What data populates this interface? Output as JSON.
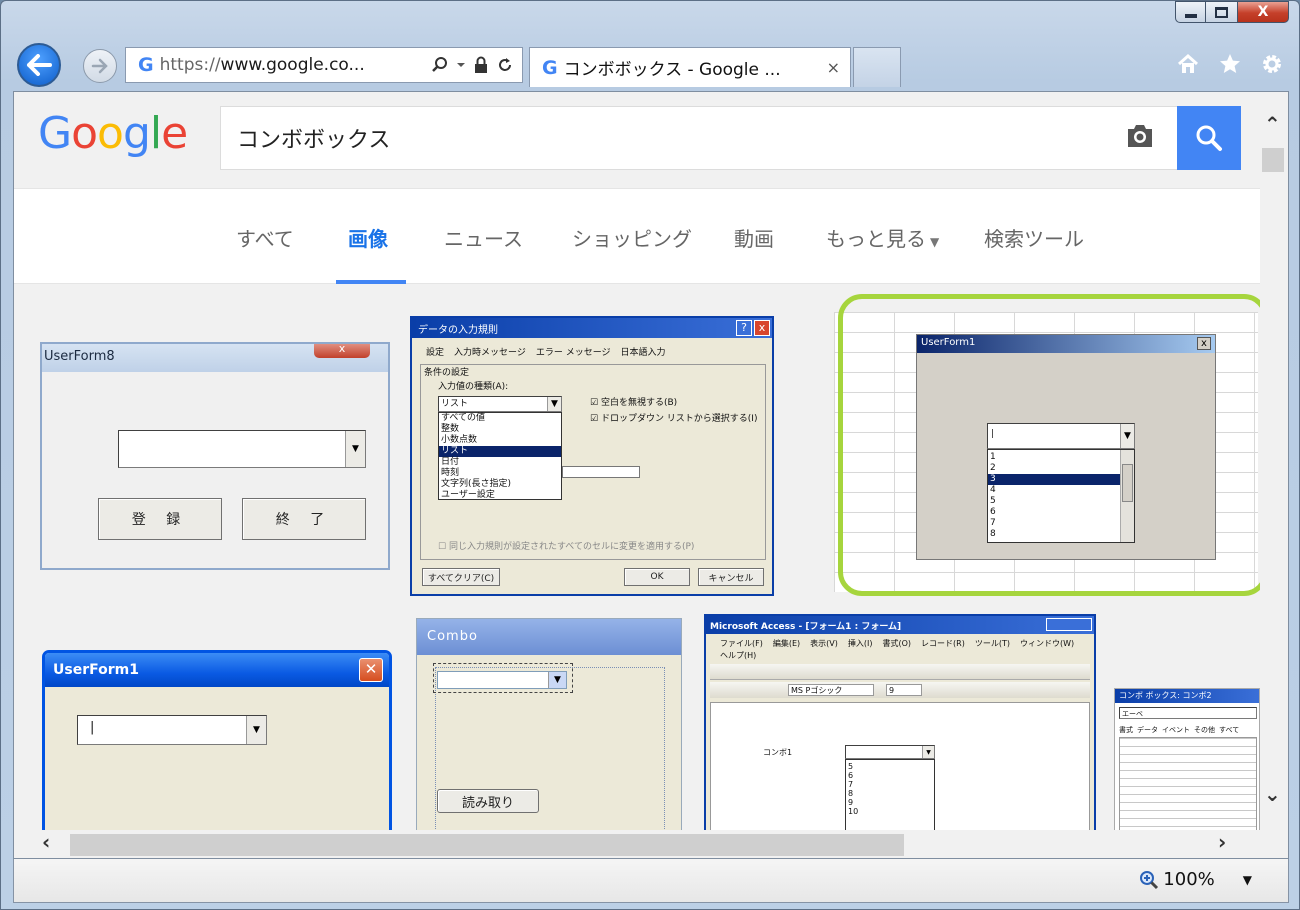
{
  "window": {
    "controls": {
      "minimize": "minimize",
      "maximize": "maximize",
      "close": "X"
    }
  },
  "browser": {
    "address": {
      "protocol": "https://",
      "rest": "www.google.co..."
    },
    "tab": {
      "favicon": "G",
      "title": "コンボボックス - Google ...",
      "close": "×"
    }
  },
  "google": {
    "logo": [
      "G",
      "o",
      "o",
      "g",
      "l",
      "e"
    ],
    "query": "コンボボックス",
    "tabs": [
      "すべて",
      "画像",
      "ニュース",
      "ショッピング",
      "動画",
      "もっと見る",
      "検索ツール"
    ],
    "active_tab": "画像"
  },
  "results": {
    "userform8": {
      "title": "UserForm8",
      "register": "登 録",
      "exit": "終 了"
    },
    "validation": {
      "title": "データの入力規則",
      "tabs": [
        "設定",
        "入力時メッセージ",
        "エラー メッセージ",
        "日本語入力"
      ],
      "group": "条件の設定",
      "kind_label": "入力値の種類(A):",
      "selected": "リスト",
      "options": [
        "すべての値",
        "整数",
        "小数点数",
        "リスト",
        "日付",
        "時刻",
        "文字列(長さ指定)",
        "ユーザー設定"
      ],
      "check1": "空白を無視する(B)",
      "check2": "ドロップダウン リストから選択する(I)",
      "apply_all": "同じ入力規則が設定されたすべてのセルに変更を適用する(P)",
      "clear_all": "すべてクリア(C)",
      "ok": "OK",
      "cancel": "キャンセル"
    },
    "userform1_list": {
      "title": "UserForm1",
      "items": [
        "1",
        "2",
        "3",
        "4",
        "5",
        "6",
        "7",
        "8"
      ],
      "selected_index": 2
    },
    "userform1_xp": {
      "title": "UserForm1"
    },
    "combo": {
      "title": "Combo",
      "read_button": "読み取り"
    },
    "access": {
      "title": "Microsoft Access - [フォーム1 : フォーム]",
      "menu": [
        "ファイル(F)",
        "編集(E)",
        "表示(V)",
        "挿入(I)",
        "書式(O)",
        "レコード(R)",
        "ツール(T)",
        "ウィンドウ(W)"
      ],
      "help": "ヘルプ(H)",
      "font": "MS Pゴシック",
      "font_size": "9",
      "label": "コンボ1",
      "list": [
        "5",
        "6",
        "7",
        "8",
        "9",
        "10"
      ]
    },
    "props": {
      "title": "コンボ ボックス: コンボ2",
      "value": "エーベ",
      "tabs": [
        "書式",
        "データ",
        "イベント",
        "その他",
        "すべて"
      ]
    }
  },
  "status": {
    "zoom": "100%"
  }
}
